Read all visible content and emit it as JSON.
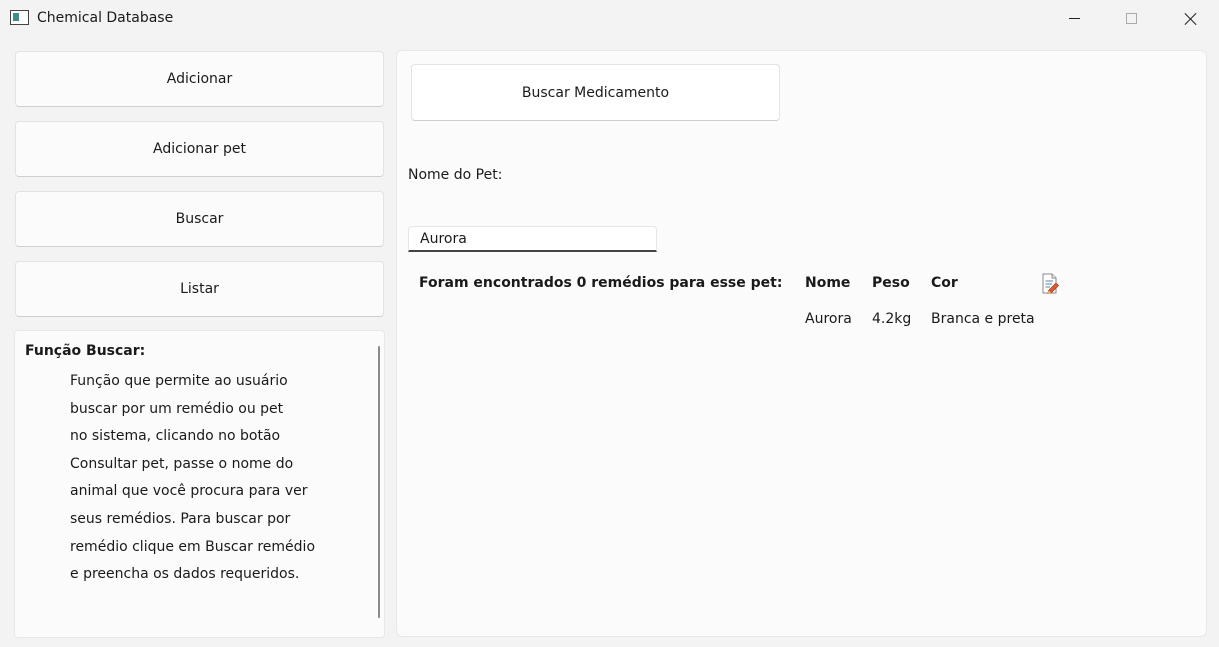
{
  "window": {
    "title": "Chemical Database"
  },
  "sidebar": {
    "buttons": [
      {
        "label": "Adicionar"
      },
      {
        "label": "Adicionar pet"
      },
      {
        "label": "Buscar"
      },
      {
        "label": "Listar"
      }
    ]
  },
  "help": {
    "title": "Função Buscar:",
    "lines": [
      "Função que permite ao usuário",
      "buscar por um remédio ou pet",
      "no sistema, clicando no botão",
      "Consultar pet, passe o nome do",
      "animal que você procura para ver",
      "seus remédios. Para buscar por",
      "remédio clique em Buscar remédio",
      "e preencha os dados requeridos."
    ]
  },
  "main": {
    "search_button_label": "Buscar Medicamento",
    "pet_name_label": "Nome do Pet:",
    "pet_name_value": "Aurora",
    "result_summary": "Foram encontrados 0 remédios para esse pet:",
    "table": {
      "columns": [
        "Nome",
        "Peso",
        "Cor"
      ],
      "rows": [
        [
          "Aurora",
          "4.2kg",
          "Branca e preta"
        ]
      ],
      "row_action_icon": "edit-document-icon"
    }
  },
  "colors": {
    "window_bg": "#f3f3f3",
    "panel_bg": "#fbfbfb",
    "icon_accent": "#e05a2b"
  }
}
